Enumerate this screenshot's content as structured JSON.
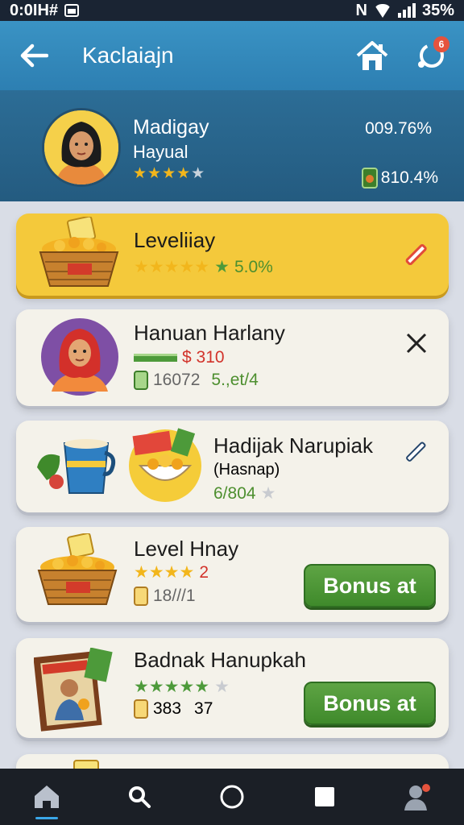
{
  "status_bar": {
    "time": "0:0IH#",
    "battery": "35%",
    "network": "N"
  },
  "app_bar": {
    "title": "Kaclaiajn",
    "notification_count": "6"
  },
  "profile": {
    "name": "Madigay",
    "subtitle": "Hayual",
    "stars": "★★★★",
    "star_empty": "★",
    "percent": "009.76%",
    "stat": "810.4%"
  },
  "cards": [
    {
      "title": "Leveliiay",
      "stars": "★★★★★",
      "star_green": "★",
      "value": "5.0%"
    },
    {
      "title": "Hanuan Harlany",
      "price": "$ 310",
      "count": "16072",
      "rate": "5.,et/4"
    },
    {
      "title": "Hadijak Narupiak",
      "subtitle": "(Hasnap)",
      "value": "6/804",
      "star": "★"
    },
    {
      "title": "Level Hnay",
      "stars": "★★★★",
      "value": "2",
      "count": "18///1",
      "button": "Bonus at"
    },
    {
      "title": "Badnak Hanupkah",
      "stars": "★★★★★",
      "star_grey": "★",
      "count": "383",
      "count2": "37",
      "button": "Bonus at"
    }
  ],
  "nav": [
    "home",
    "search",
    "circle",
    "square",
    "profile"
  ],
  "colors": {
    "app_bar": "#2d7fb2",
    "profile_bg": "#245b80",
    "gold_card": "#f4c93b",
    "bonus_green": "#4d9a3a"
  }
}
